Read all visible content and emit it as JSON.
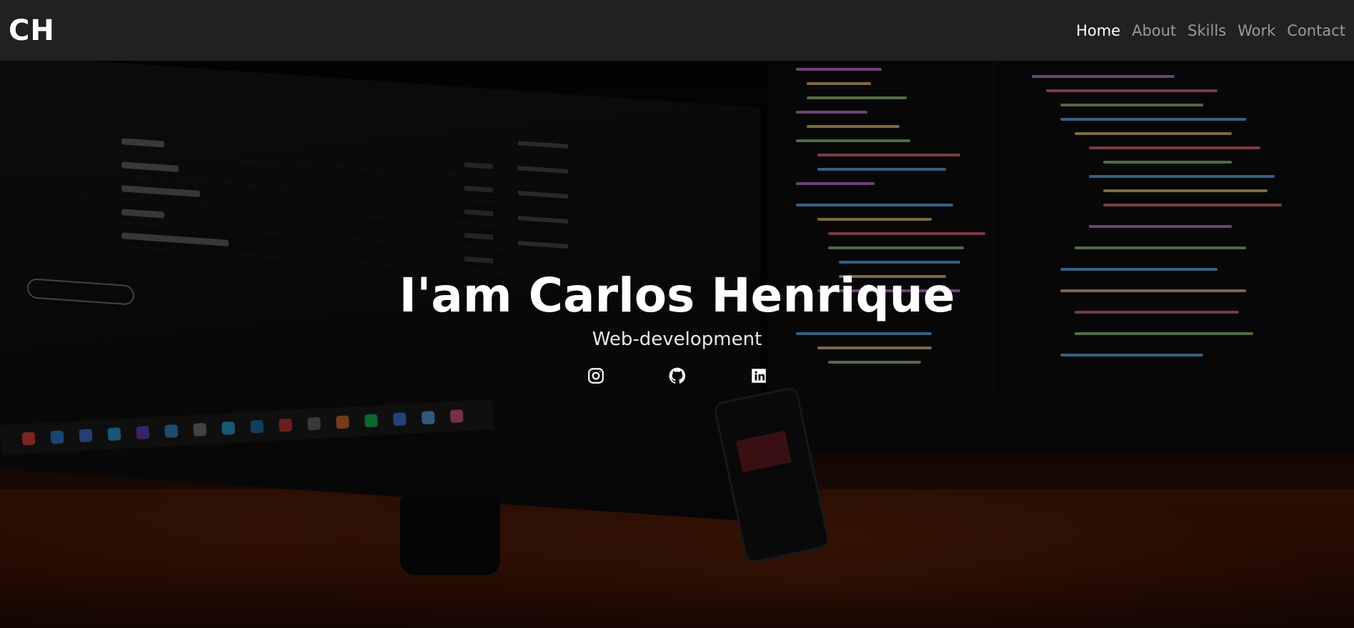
{
  "navbar": {
    "logo": "CH",
    "links": [
      {
        "label": "Home",
        "active": true
      },
      {
        "label": "About",
        "active": false
      },
      {
        "label": "Skills",
        "active": false
      },
      {
        "label": "Work",
        "active": false
      },
      {
        "label": "Contact",
        "active": false
      }
    ]
  },
  "hero": {
    "title": "I'am Carlos Henrique",
    "subtitle": "Web-development",
    "social": [
      {
        "name": "instagram",
        "icon": "instagram-icon"
      },
      {
        "name": "github",
        "icon": "github-icon"
      },
      {
        "name": "linkedin",
        "icon": "linkedin-icon"
      }
    ]
  },
  "colors": {
    "navbar_bg": "#212121",
    "nav_active": "#ffffff",
    "nav_inactive": "#9a9a9a",
    "hero_text": "#ffffff"
  }
}
